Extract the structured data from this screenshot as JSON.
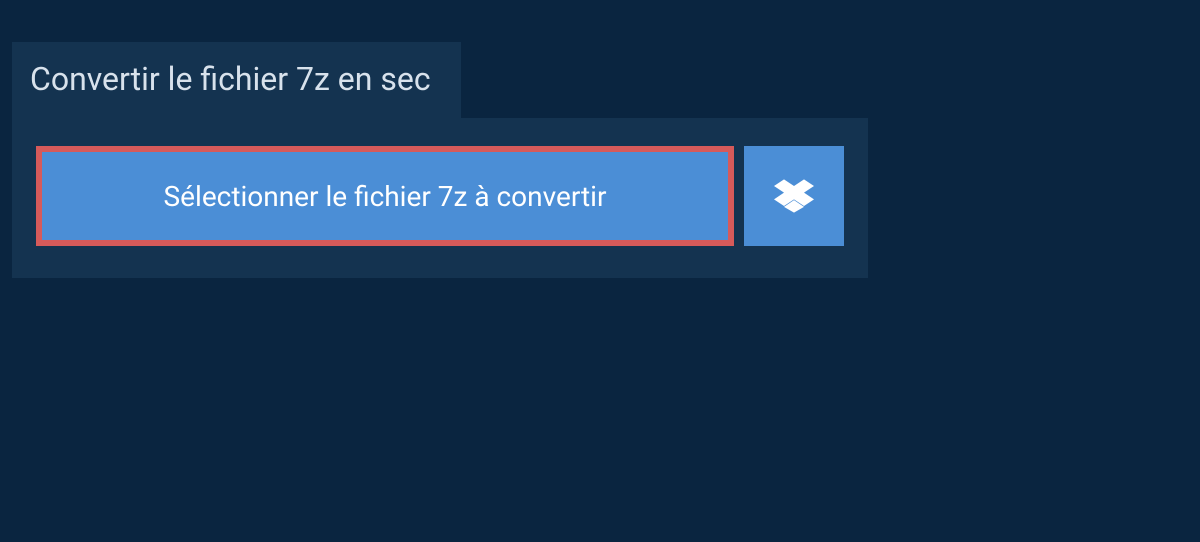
{
  "header": {
    "tab_label": "Convertir le fichier 7z en sec"
  },
  "main": {
    "select_button_label": "Sélectionner le fichier 7z à convertir"
  },
  "colors": {
    "background": "#0a2540",
    "panel": "#143350",
    "button": "#4b8ed6",
    "highlight_border": "#d65a5a",
    "text_light": "#d8e2ec",
    "text_white": "#ffffff"
  }
}
